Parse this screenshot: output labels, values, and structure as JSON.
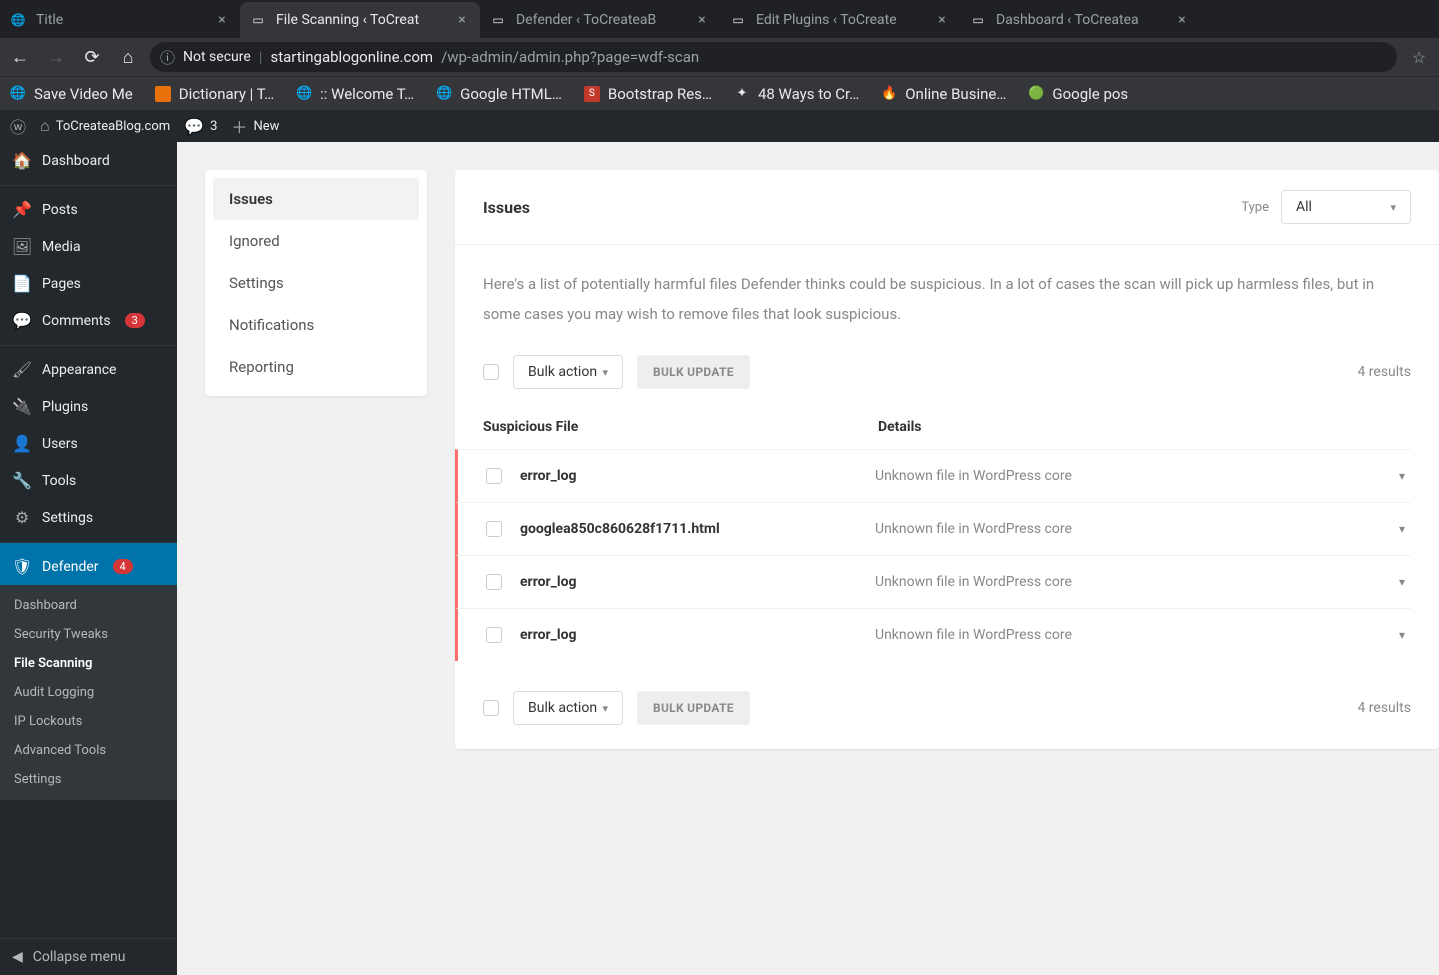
{
  "browser": {
    "tabs": [
      {
        "title": "Title",
        "active": false
      },
      {
        "title": "File Scanning ‹ ToCreat",
        "active": true
      },
      {
        "title": "Defender ‹ ToCreateaB",
        "active": false
      },
      {
        "title": "Edit Plugins ‹ ToCreate",
        "active": false
      },
      {
        "title": "Dashboard ‹ ToCreatea",
        "active": false
      }
    ],
    "not_secure": "Not secure",
    "url_host": "startingablogonline.com",
    "url_path": "/wp-admin/admin.php?page=wdf-scan",
    "bookmarks": [
      "Save Video Me",
      "Dictionary | T…",
      ":: Welcome T…",
      "Google HTML…",
      "Bootstrap Res…",
      "48 Ways to Cr…",
      "Online Busine…",
      "Google pos"
    ]
  },
  "adminbar": {
    "site": "ToCreateaBlog.com",
    "comments": "3",
    "new": "New"
  },
  "sidebar": {
    "dashboard": "Dashboard",
    "posts": "Posts",
    "media": "Media",
    "pages": "Pages",
    "comments": "Comments",
    "comments_count": "3",
    "appearance": "Appearance",
    "plugins": "Plugins",
    "users": "Users",
    "tools": "Tools",
    "settings": "Settings",
    "defender": "Defender",
    "defender_count": "4",
    "submenu": {
      "dashboard": "Dashboard",
      "tweaks": "Security Tweaks",
      "filescan": "File Scanning",
      "audit": "Audit Logging",
      "iplock": "IP Lockouts",
      "adv": "Advanced Tools",
      "settings": "Settings"
    },
    "collapse": "Collapse menu"
  },
  "sidetabs": {
    "issues": "Issues",
    "ignored": "Ignored",
    "settings": "Settings",
    "notifications": "Notifications",
    "reporting": "Reporting"
  },
  "main": {
    "heading": "Issues",
    "type_label": "Type",
    "type_value": "All",
    "description_1": "Here's a list of potentially harmful files Defender thinks could be suspicious. In a lot of cases the scan will pick up harmless files, but in some cases you may wish to",
    "description_2": "remove files that look suspicious.",
    "bulk_action": "Bulk action",
    "bulk_update": "BULK UPDATE",
    "results": "4 results",
    "col_file": "Suspicious File",
    "col_details": "Details",
    "rows": [
      {
        "file": "error_log",
        "details": "Unknown file in WordPress core"
      },
      {
        "file": "googlea850c860628f1711.html",
        "details": "Unknown file in WordPress core"
      },
      {
        "file": "error_log",
        "details": "Unknown file in WordPress core"
      },
      {
        "file": "error_log",
        "details": "Unknown file in WordPress core"
      }
    ]
  }
}
